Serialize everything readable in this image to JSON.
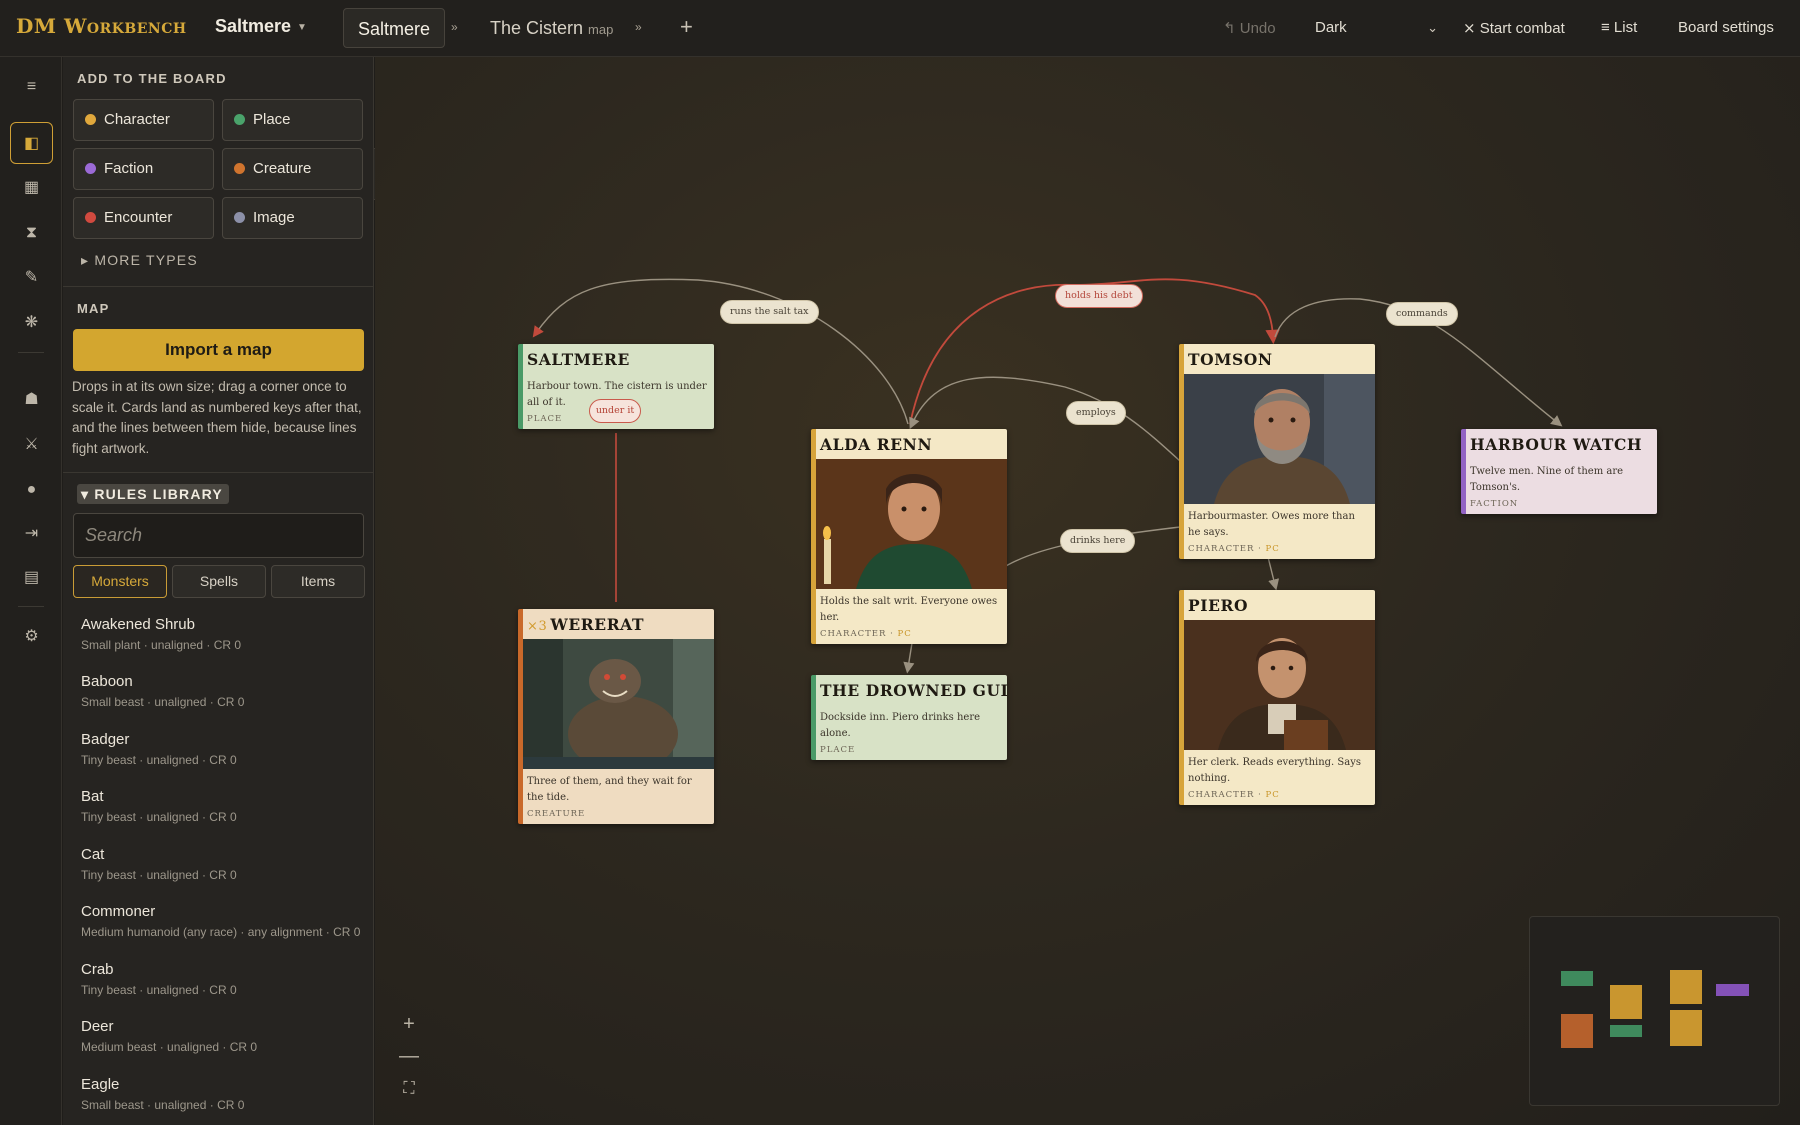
{
  "app": {
    "brand": "DM Workbench"
  },
  "header": {
    "board_name": "Saltmere",
    "tabs": [
      {
        "label": "Saltmere",
        "sub": ""
      },
      {
        "label": "The Cistern",
        "sub": "map"
      }
    ],
    "undo_label": "Undo",
    "theme_value": "Dark",
    "start_combat_label": "Start combat",
    "list_label": "List",
    "board_settings_label": "Board settings"
  },
  "panel": {
    "add_title": "ADD TO THE BOARD",
    "types": [
      {
        "label": "Character",
        "color": "#e0a83c"
      },
      {
        "label": "Place",
        "color": "#4aa36b"
      },
      {
        "label": "Faction",
        "color": "#9b6ad6"
      },
      {
        "label": "Creature",
        "color": "#d0742e"
      },
      {
        "label": "Encounter",
        "color": "#d14a3f"
      },
      {
        "label": "Image",
        "color": "#8c90a8"
      }
    ],
    "more_types_label": "MORE TYPES",
    "map_title": "MAP",
    "import_label": "Import a map",
    "map_help": "Drops in at its own size; drag a corner once to scale it. Cards land as numbered keys after that, and the lines between them hide, because lines fight artwork.",
    "rules_title": "RULES LIBRARY",
    "search_placeholder": "Search",
    "lib_tabs": [
      "Monsters",
      "Spells",
      "Items"
    ],
    "monsters": [
      {
        "name": "Awakened Shrub",
        "meta": "Small plant · unaligned · CR 0"
      },
      {
        "name": "Baboon",
        "meta": "Small beast · unaligned · CR 0"
      },
      {
        "name": "Badger",
        "meta": "Tiny beast · unaligned · CR 0"
      },
      {
        "name": "Bat",
        "meta": "Tiny beast · unaligned · CR 0"
      },
      {
        "name": "Cat",
        "meta": "Tiny beast · unaligned · CR 0"
      },
      {
        "name": "Commoner",
        "meta": "Medium humanoid (any race) · any alignment · CR 0"
      },
      {
        "name": "Crab",
        "meta": "Tiny beast · unaligned · CR 0"
      },
      {
        "name": "Deer",
        "meta": "Medium beast · unaligned · CR 0"
      },
      {
        "name": "Eagle",
        "meta": "Small beast · unaligned · CR 0"
      }
    ]
  },
  "board": {
    "cards": {
      "saltmere": {
        "title": "SALTMERE",
        "desc": "Harbour town. The cistern is under all of it.",
        "kind": "PLACE"
      },
      "wererat": {
        "count": "×3",
        "title": "WERERAT",
        "desc": "Three of them, and they wait for the tide.",
        "kind": "CREATURE"
      },
      "alda": {
        "title": "ALDA RENN",
        "desc": "Holds the salt writ. Everyone owes her.",
        "kind": "CHARACTER",
        "tag": "PC"
      },
      "gull": {
        "title": "THE DROWNED GULL",
        "desc": "Dockside inn. Piero drinks here alone.",
        "kind": "PLACE"
      },
      "tomson": {
        "title": "TOMSON",
        "desc": "Harbourmaster. Owes more than he says.",
        "kind": "CHARACTER",
        "tag": "PC"
      },
      "piero": {
        "title": "PIERO",
        "desc": "Her clerk. Reads everything. Says nothing.",
        "kind": "CHARACTER",
        "tag": "PC"
      },
      "harbour": {
        "title": "HARBOUR WATCH",
        "desc": "Twelve men. Nine of them are Tomson's.",
        "kind": "FACTION"
      }
    },
    "edge_labels": {
      "salt_tax": "runs the salt tax",
      "debt": "holds his debt",
      "commands": "commands",
      "employs": "employs",
      "drinks": "drinks here",
      "under": "under it"
    }
  },
  "colors": {
    "accent": "#d3a62f",
    "character": "#d7a43a",
    "place": "#4a9a67",
    "faction": "#9263c4",
    "creature": "#c9692a",
    "relation_red": "#c24a3c"
  }
}
